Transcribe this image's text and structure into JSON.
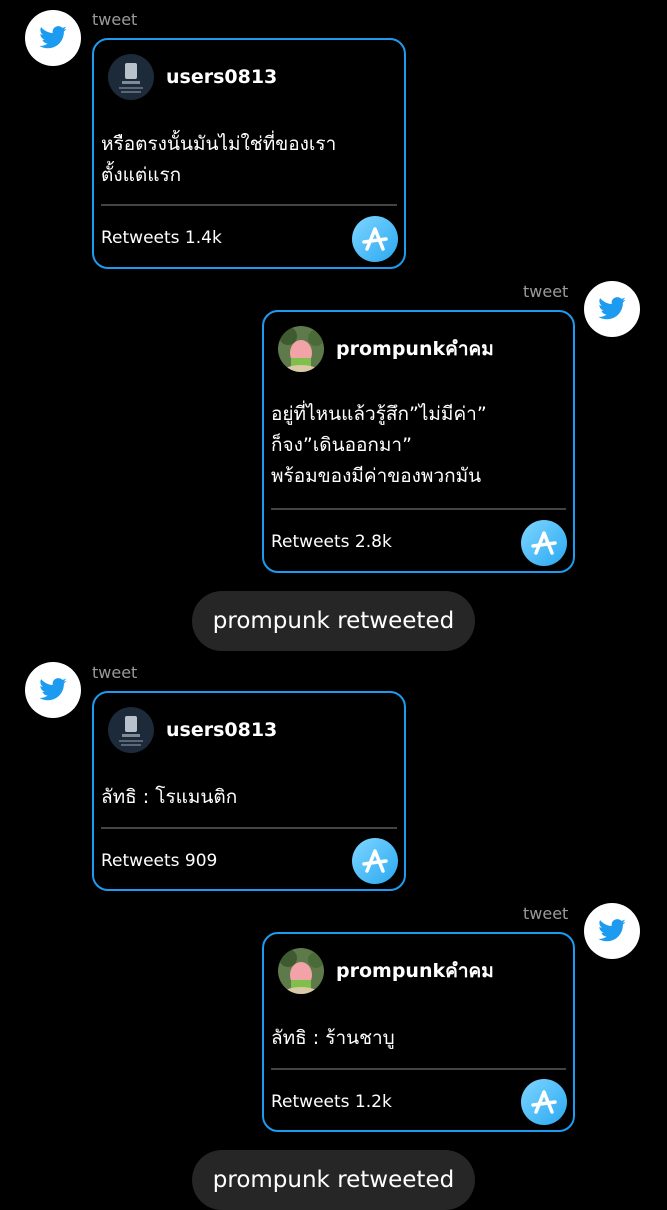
{
  "colors": {
    "background": "#000000",
    "card_border": "#1d9bf0",
    "pill_background": "#262626",
    "badge_accent": "#2aa8f2"
  },
  "messages": [
    {
      "label": "tweet",
      "username": "users0813",
      "text": "หรือตรงนั้นมันไม่ใช่ที่ของเรา\nตั้งแต่แรก",
      "retweets": "Retweets 1.4k"
    },
    {
      "label": "tweet",
      "username": "prompunkคำคม",
      "text": "อยู่ที่ไหนแล้วรู้สึก”ไม่มีค่า”\nก็จง”เดินออกมา”\nพร้อมของมีค่าของพวกมัน",
      "retweets": "Retweets 2.8k"
    },
    {
      "label": "tweet",
      "username": "users0813",
      "text": "ลัทธิ : โรแมนติก",
      "retweets": "Retweets 909"
    },
    {
      "label": "tweet",
      "username": "prompunkคำคม",
      "text": "ลัทธิ : ร้านชาบู",
      "retweets": "Retweets 1.2k"
    }
  ],
  "system_messages": [
    "prompunk retweeted",
    "prompunk retweeted"
  ],
  "icons": {
    "bird": "twitter-bird-icon",
    "badge": "a-badge-icon"
  }
}
